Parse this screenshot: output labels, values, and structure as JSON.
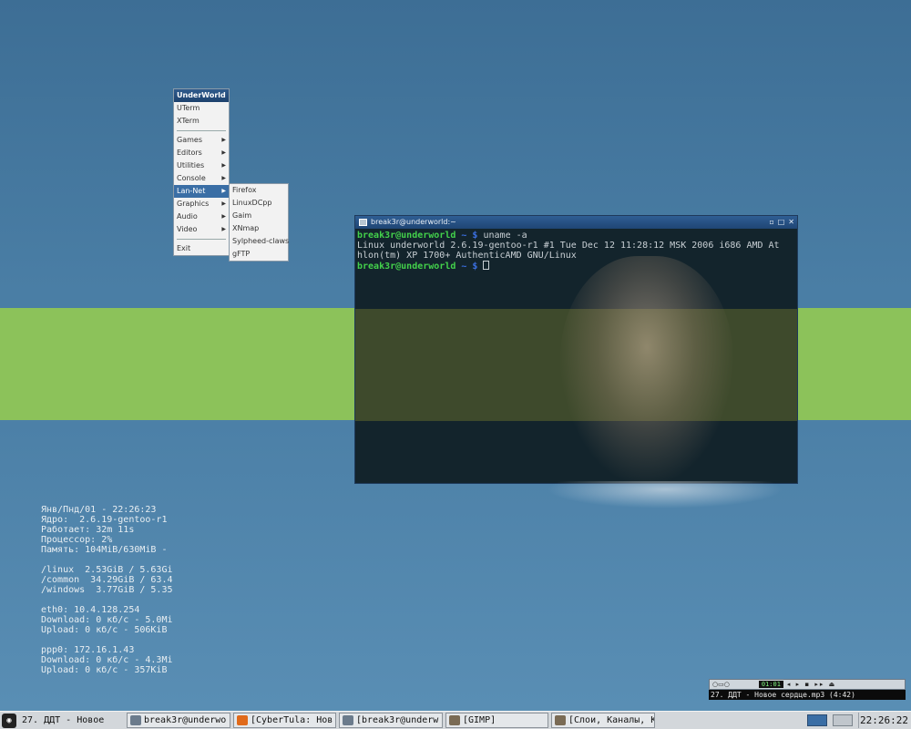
{
  "menu": {
    "title": "UnderWorld",
    "groups": [
      [
        "UTerm",
        "XTerm"
      ],
      [
        "Games",
        "Editors",
        "Utilities",
        "Console",
        "Lan-Net",
        "Graphics",
        "Audio",
        "Video"
      ],
      [
        "Exit"
      ]
    ],
    "active": "Lan-Net",
    "submenu": [
      "Firefox",
      "LinuxDCpp",
      "Gaim",
      "XNmap",
      "Sylpheed-claws",
      "gFTP"
    ]
  },
  "terminal": {
    "title": "break3r@underworld:~",
    "window_buttons": [
      "▫",
      "□",
      "✕"
    ],
    "prompt_user": "break3r@underworld",
    "prompt_path": " ~ $ ",
    "command": "uname -a",
    "output": "Linux underworld 2.6.19-gentoo-r1 #1 Tue Dec 12 11:28:12 MSK 2006 i686 AMD At\nhlon(tm) XP 1700+ AuthenticAMD GNU/Linux"
  },
  "conky": {
    "lines": [
      "Янв/Пнд/01 - 22:26:23",
      "Ядро:  2.6.19-gentoo-r1",
      "Работает: 32m 11s",
      "Процессор: 2%",
      "Память: 104MiB/630MiB -",
      "",
      "/linux  2.53GiB / 5.63Gi",
      "/common  34.29GiB / 63.4",
      "/windows  3.77GiB / 5.35",
      "",
      "eth0: 10.4.128.254",
      "Download: 0 кб/с - 5.0Mi",
      "Upload: 0 кб/с - 506KiB",
      "",
      "ppp0: 172.16.1.43",
      "Download: 0 кб/с - 4.3Mi",
      "Upload: 0 кб/с - 357KiB"
    ]
  },
  "player": {
    "time": "01:01",
    "buttons": "◂ ▸ ▪ ▸▸ ⏏",
    "track": "27. ДДТ - Новое сердце.mp3 (4:42)"
  },
  "taskbar": {
    "start_icon": "openbox-icon",
    "items": [
      {
        "label": "27. ДДТ - Новое",
        "icon": "none",
        "color": "transparent",
        "plain": true
      },
      {
        "label": "break3r@underwo",
        "icon": "terminal-icon",
        "color": "#6b7b8c"
      },
      {
        "label": "[CyberTula: Нов",
        "icon": "firefox-icon",
        "color": "#e06a1a"
      },
      {
        "label": "[break3r@underw",
        "icon": "terminal-icon",
        "color": "#6b7b8c"
      },
      {
        "label": "[GIMP]",
        "icon": "gimp-icon",
        "color": "#7a6b55"
      },
      {
        "label": "[Слои, Каналы, К",
        "icon": "gimp-icon",
        "color": "#7a6b55"
      }
    ],
    "clock": "22:26:22"
  },
  "colors": {
    "desktop_blue": "#4a7ea5",
    "band_green": "#8cc25a",
    "prompt_green": "#43d14b",
    "title_blue": "#2f5e94"
  }
}
